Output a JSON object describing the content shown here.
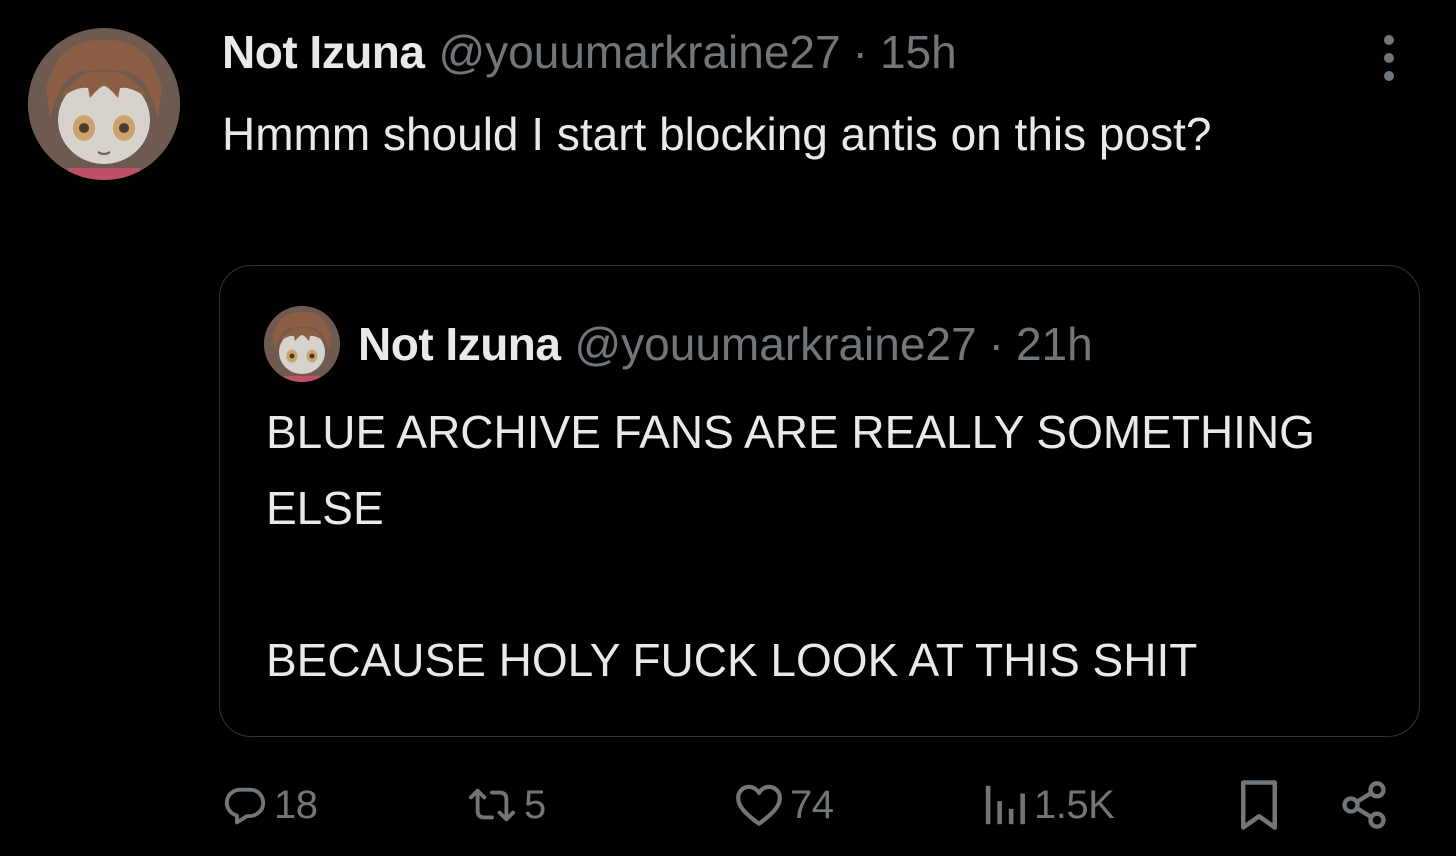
{
  "post": {
    "author_name": "Not Izuna",
    "author_handle": "@youumarkraine27",
    "separator": "·",
    "time": "15h",
    "text": "Hmmm should I start blocking antis on this post?"
  },
  "quoted_post": {
    "author_name": "Not Izuna",
    "author_handle": "@youumarkraine27",
    "separator": "·",
    "time": "21h",
    "text": "BLUE ARCHIVE FANS ARE REALLY SOMETHING ELSE\n\nBECAUSE HOLY FUCK LOOK AT THIS SHIT"
  },
  "actions": {
    "replies": "18",
    "reposts": "5",
    "likes": "74",
    "views": "1.5K"
  },
  "icons": {
    "more": "more-vertical-icon",
    "reply": "reply-bubble-icon",
    "repost": "repost-icon",
    "like": "heart-icon",
    "views": "views-bars-icon",
    "bookmark": "bookmark-icon",
    "share": "share-icon"
  },
  "colors": {
    "background": "#000000",
    "primary_text": "#e7e9ea",
    "secondary_text": "#71767b",
    "border": "#2f3336"
  }
}
